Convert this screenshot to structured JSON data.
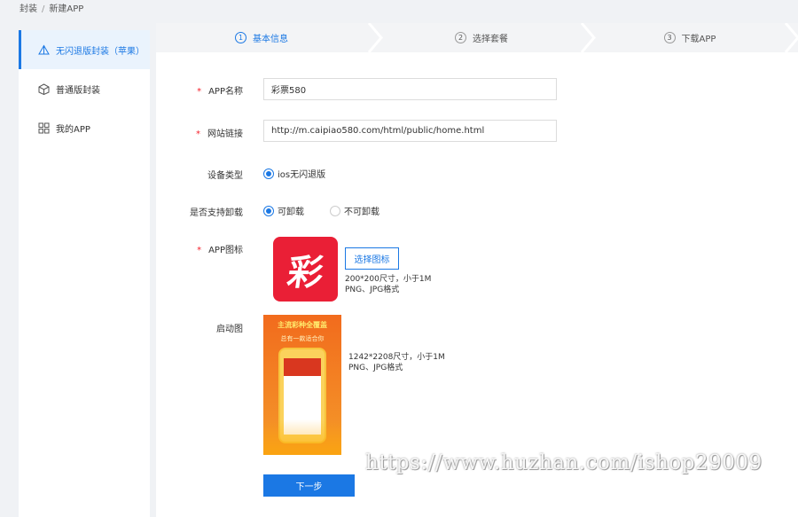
{
  "breadcrumb": {
    "root": "封装",
    "separator": "/",
    "current": "新建APP"
  },
  "sidebar": {
    "items": [
      {
        "label": "无闪退版封装（苹果）",
        "icon": "triangle-icon",
        "active": true
      },
      {
        "label": "普通版封装",
        "icon": "cube-icon",
        "active": false
      },
      {
        "label": "我的APP",
        "icon": "grid-icon",
        "active": false
      }
    ]
  },
  "steps": [
    {
      "num": "1",
      "label": "基本信息",
      "active": true
    },
    {
      "num": "2",
      "label": "选择套餐",
      "active": false
    },
    {
      "num": "3",
      "label": "下载APP",
      "active": false
    }
  ],
  "form": {
    "app_name": {
      "label": "APP名称",
      "required": "*",
      "value": "彩票580"
    },
    "site_url": {
      "label": "网站链接",
      "required": "*",
      "value": "http://m.caipiao580.com/html/public/home.html"
    },
    "device_type": {
      "label": "设备类型",
      "option": "ios无闪退版"
    },
    "uninstall": {
      "label": "是否支持卸载",
      "options": [
        "可卸载",
        "不可卸载"
      ],
      "selected": "可卸载"
    },
    "app_icon": {
      "label": "APP图标",
      "required": "*",
      "glyph": "彩",
      "button": "选择图标",
      "hint_line1": "200*200尺寸，小于1M",
      "hint_line2": "PNG、JPG格式"
    },
    "launch_image": {
      "label": "启动图",
      "banner_line1": "主流彩种全覆盖",
      "banner_line2": "总有一款适合你",
      "hint_line1": "1242*2208尺寸，小于1M",
      "hint_line2": "PNG、JPG格式"
    },
    "next_button": "下一步"
  },
  "watermark": "https://www.huzhan.com/ishop29009",
  "colors": {
    "accent": "#1b78e4",
    "required": "#f5222d",
    "icon_bg": "#ea1f36"
  }
}
